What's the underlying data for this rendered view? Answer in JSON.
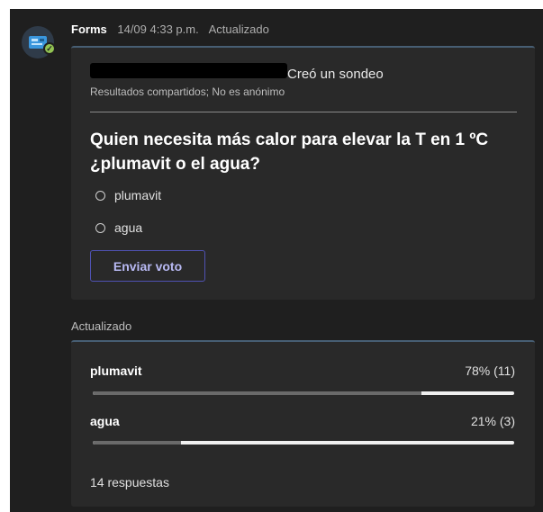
{
  "header": {
    "app_name": "Forms",
    "timestamp": "14/09 4:33 p.m.",
    "status": "Actualizado",
    "avatar_icon": "forms-app-icon",
    "badge_icon": "check-icon",
    "badge_color": "#92c353"
  },
  "poll": {
    "creator_action": "Creó un sondeo",
    "subtitle": "Resultados compartidos; No es anónimo",
    "question": "Quien necesita más calor para elevar la T en 1 ºC ¿plumavit o el agua?",
    "options": [
      {
        "label": "plumavit"
      },
      {
        "label": "agua"
      }
    ],
    "submit_label": "Enviar voto",
    "accent_color": "#4f52b2"
  },
  "results": {
    "section_label": "Actualizado",
    "items": [
      {
        "label": "plumavit",
        "value_text": "78% (11)",
        "percent": 78
      },
      {
        "label": "agua",
        "value_text": "21% (3)",
        "percent": 21
      }
    ],
    "responses_text": "14 respuestas"
  }
}
